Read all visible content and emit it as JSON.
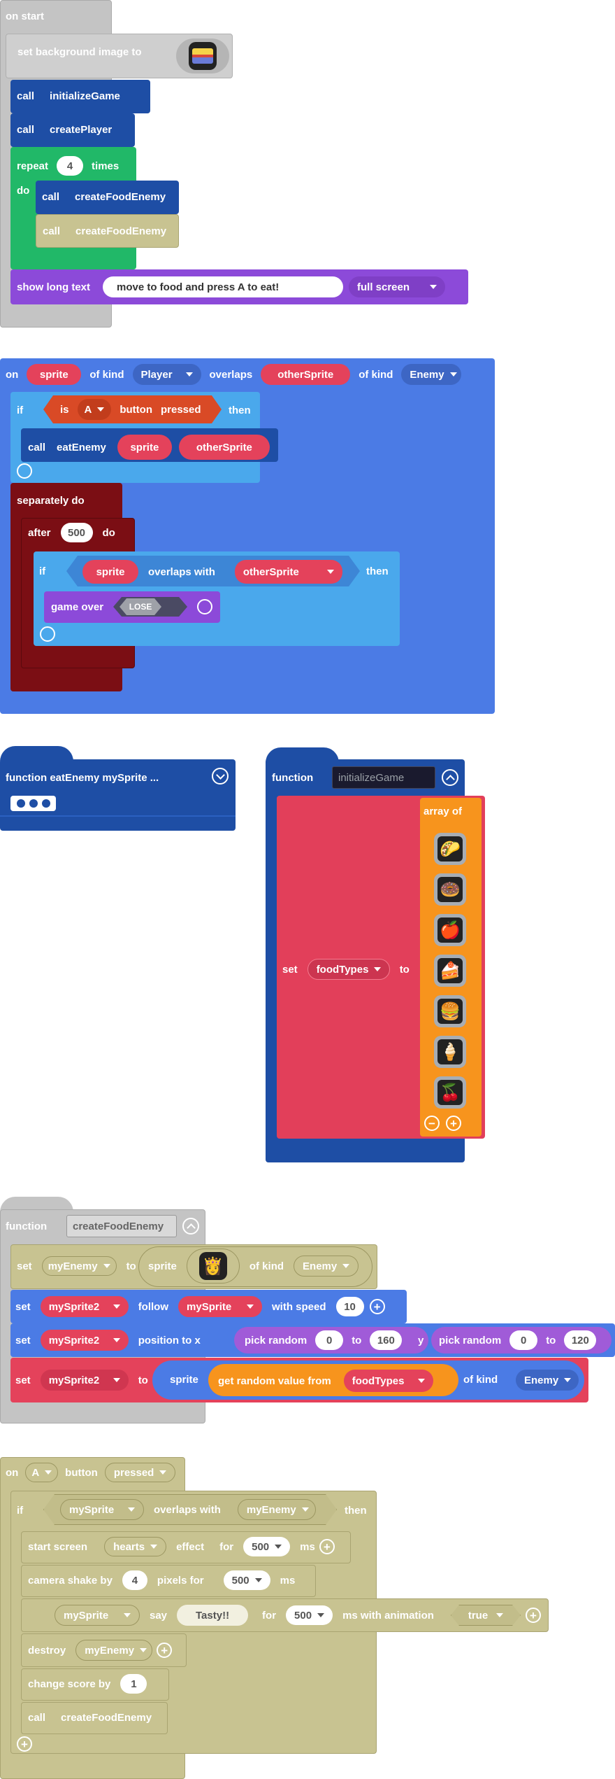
{
  "on_start": {
    "header": "on start",
    "bg_label": "set background image to",
    "call1_kw": "call",
    "call1_fn": "initializeGame",
    "call2_kw": "call",
    "call2_fn": "createPlayer",
    "repeat_kw": "repeat",
    "repeat_count": "4",
    "times_kw": "times",
    "do_kw": "do",
    "call3_kw": "call",
    "call3_fn": "createFoodEnemy",
    "call4_kw": "call",
    "call4_fn": "createFoodEnemy",
    "show_kw": "show long text",
    "show_text": "move to food and press A to eat!",
    "show_mode": "full screen"
  },
  "overlap_event": {
    "on_kw": "on",
    "sprite_var": "sprite",
    "of_kind_1": "of kind",
    "kind1": "Player",
    "overlaps_kw": "overlaps",
    "other_var": "otherSprite",
    "of_kind_2": "of kind",
    "kind2": "Enemy",
    "if_kw": "if",
    "is_kw": "is",
    "button": "A",
    "button_kw": "button",
    "pressed_kw": "pressed",
    "then_kw": "then",
    "call_kw": "call",
    "call_fn": "eatEnemy",
    "arg1": "sprite",
    "arg2": "otherSprite",
    "separately_kw": "separately do",
    "after_kw": "after",
    "after_ms": "500",
    "after_do": "do",
    "if2_kw": "if",
    "if2_sprite": "sprite",
    "overlaps_with_kw": "overlaps with",
    "if2_other": "otherSprite",
    "if2_then": "then",
    "gameover_kw": "game over",
    "lose_label": "LOSE"
  },
  "fn_eat": {
    "label": "function eatEnemy mySprite ..."
  },
  "fn_init": {
    "kw": "function",
    "name": "initializeGame",
    "set_kw": "set",
    "var": "foodTypes",
    "to_kw": "to",
    "array_kw": "array of",
    "items": [
      "🌮",
      "🍩",
      "🍎",
      "🍰",
      "🍔",
      "🍦",
      "🍒"
    ]
  },
  "fn_create": {
    "kw": "function",
    "name": "createFoodEnemy",
    "r1_set": "set",
    "r1_var": "myEnemy",
    "r1_to": "to",
    "r1_sprite": "sprite",
    "r1_ofkind": "of kind",
    "r1_kind": "Enemy",
    "r2_set": "set",
    "r2_var": "mySprite2",
    "r2_follow": "follow",
    "r2_target": "mySprite",
    "r2_speed_kw": "with speed",
    "r2_speed": "10",
    "r3_set": "set",
    "r3_var": "mySprite2",
    "r3_pos": "position to x",
    "r3_pick1": "pick random",
    "r3_a1": "0",
    "r3_to1": "to",
    "r3_b1": "160",
    "r3_y": "y",
    "r3_pick2": "pick random",
    "r3_a2": "0",
    "r3_to2": "to",
    "r3_b2": "120",
    "r4_set": "set",
    "r4_var": "mySprite2",
    "r4_to": "to",
    "r4_sprite": "sprite",
    "r4_get": "get random value from",
    "r4_list": "foodTypes",
    "r4_ofkind": "of kind",
    "r4_kind": "Enemy"
  },
  "a_event": {
    "on_kw": "on",
    "button": "A",
    "button_kw": "button",
    "state": "pressed",
    "if_kw": "if",
    "if_sprite": "mySprite",
    "overlaps_kw": "overlaps with",
    "if_other": "myEnemy",
    "then_kw": "then",
    "s1_kw": "start screen",
    "s1_effect": "hearts",
    "s1_effect_kw": "effect",
    "s1_for": "for",
    "s1_ms": "500",
    "s1_unit": "ms",
    "s2_kw": "camera shake by",
    "s2_px": "4",
    "s2_px_kw": "pixels for",
    "s2_ms": "500",
    "s2_unit": "ms",
    "s3_sprite": "mySprite",
    "s3_say": "say",
    "s3_text": "Tasty!!",
    "s3_for": "for",
    "s3_ms": "500",
    "s3_anim": "ms with animation",
    "s3_bool": "true",
    "s4_kw": "destroy",
    "s4_var": "myEnemy",
    "s5_kw": "change score by",
    "s5_val": "1",
    "s6_kw": "call",
    "s6_fn": "createFoodEnemy"
  },
  "colors": {
    "event_gray": "#c4c4c4",
    "sprite_blue": "#4b7be5",
    "func_blue": "#1e4ea5",
    "logic_blue": "#4aa8ec",
    "loop_green": "#21b868",
    "looks_purple": "#8c4ad9",
    "var_red": "#e4425b",
    "control_maroon": "#7b0e14",
    "deprecated_khaki": "#c8c391",
    "controller_red": "#d94a26",
    "array_orange": "#f7941d"
  }
}
